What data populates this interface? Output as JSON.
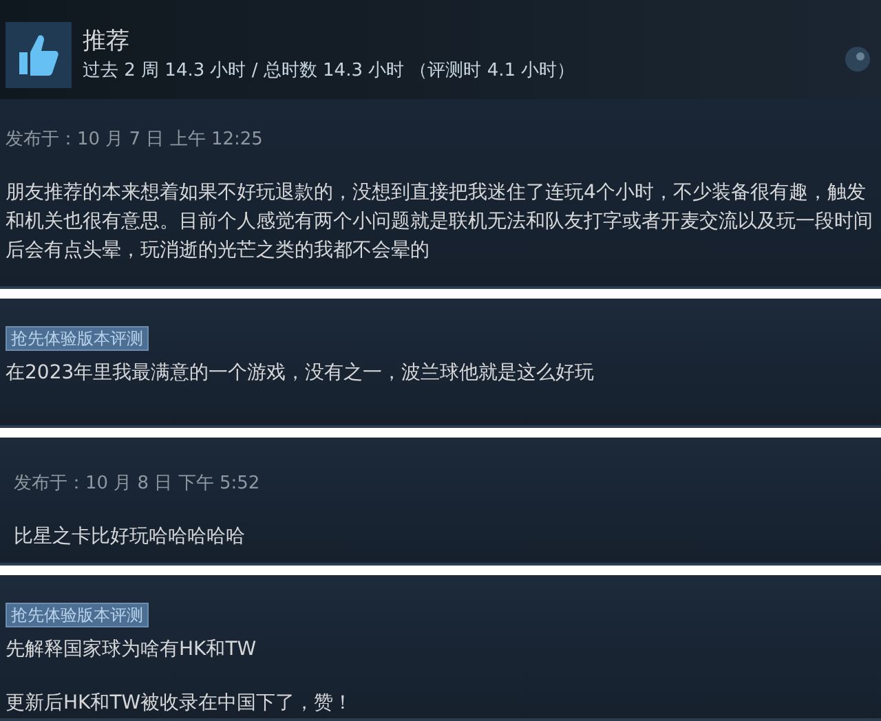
{
  "reviews": [
    {
      "kind": "recommendation",
      "verdict": "推荐",
      "hours": "过去 2 周 14.3 小时 / 总时数 14.3 小时 （评测时 4.1 小时）",
      "posted": "发布于：10 月 7 日 上午 12:25",
      "paragraphs": [
        "朋友推荐的本来想着如果不好玩退款的，没想到直接把我迷住了连玩4个小时，不少装备很有趣，触发和机关也很有意思。目前个人感觉有两个小问题就是联机无法和队友打字或者开麦交流以及玩一段时间后会有点头晕，玩消逝的光芒之类的我都不会晕的"
      ]
    },
    {
      "kind": "plain",
      "badge": "抢先体验版本评测",
      "paragraphs": [
        "在2023年里我最满意的一个游戏，没有之一，波兰球他就是这么好玩"
      ]
    },
    {
      "kind": "plain",
      "posted": "发布于：10 月 8 日 下午 5:52",
      "paragraphs": [
        "比星之卡比好玩哈哈哈哈哈"
      ]
    },
    {
      "kind": "plain",
      "badge": "抢先体验版本评测",
      "paragraphs": [
        "先解释国家球为啥有HK和TW",
        "更新后HK和TW被收录在中国下了，赞！"
      ]
    }
  ]
}
